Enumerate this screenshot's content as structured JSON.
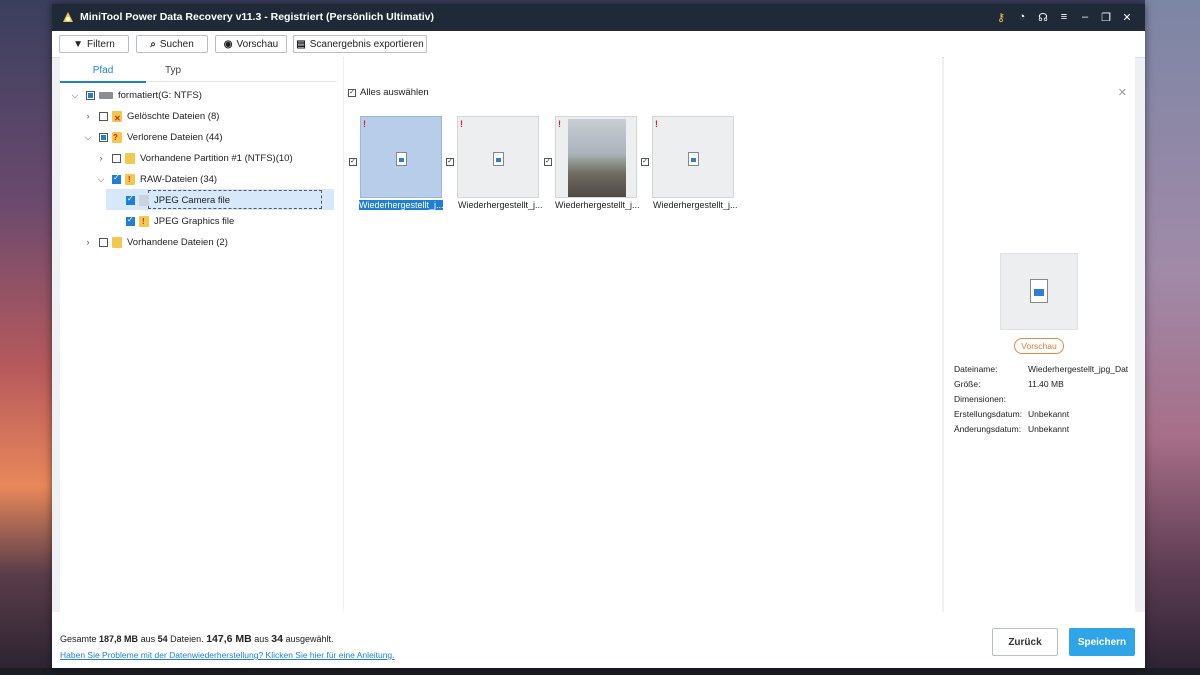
{
  "window": {
    "title": "MiniTool Power Data Recovery v11.3 - Registriert (Persönlich Ultimativ)"
  },
  "toolbar": {
    "filter_label": "Filtern",
    "search_label": "Suchen",
    "preview_label": "Vorschau",
    "export_label": "Scanergebnis exportieren"
  },
  "tabs": {
    "path": "Pfad",
    "type": "Typ"
  },
  "tree": {
    "root": "formatiert(G: NTFS)",
    "deleted": "Gelöschte Dateien (8)",
    "lost": "Verlorene Dateien (44)",
    "partition": "Vorhandene Partition #1 (NTFS)(10)",
    "raw": "RAW-Dateien (34)",
    "jpeg_camera": "JPEG Camera file",
    "jpeg_graphics": "JPEG Graphics file",
    "existing": "Vorhandene Dateien (2)"
  },
  "content": {
    "select_all": "Alles auswählen",
    "items": [
      {
        "label": "Wiederhergestellt_j..."
      },
      {
        "label": "Wiederhergestellt_j..."
      },
      {
        "label": "Wiederhergestellt_j..."
      },
      {
        "label": "Wiederhergestellt_j..."
      }
    ]
  },
  "preview_panel": {
    "preview_button": "Vorschau",
    "filename_label": "Dateiname:",
    "filename_value": "Wiederhergestellt_jpg_Date",
    "size_label": "Größe:",
    "size_value": "11.40 MB",
    "dimensions_label": "Dimensionen:",
    "created_label": "Erstellungsdatum:",
    "created_value": "Unbekannt",
    "modified_label": "Änderungsdatum:",
    "modified_value": "Unbekannt"
  },
  "footer": {
    "stat_prefix": "Gesamte",
    "total_size": "187,8 MB",
    "stat_mid1": "aus",
    "total_files": "54",
    "stat_mid2": "Dateien.",
    "selected_size": "147,6 MB",
    "stat_mid3": "aus",
    "selected_files": "34",
    "stat_suffix": "ausgewählt.",
    "help_link": "Haben Sie Probleme mit der Datenwiederherstellung? Klicken Sie hier für eine Anleitung.",
    "back_label": "Zurück",
    "save_label": "Speichern"
  },
  "colors": {
    "accent": "#1f7fd6",
    "save": "#2fa4e7",
    "titlebar": "#1f2937",
    "preview_button": "#e07a30"
  }
}
